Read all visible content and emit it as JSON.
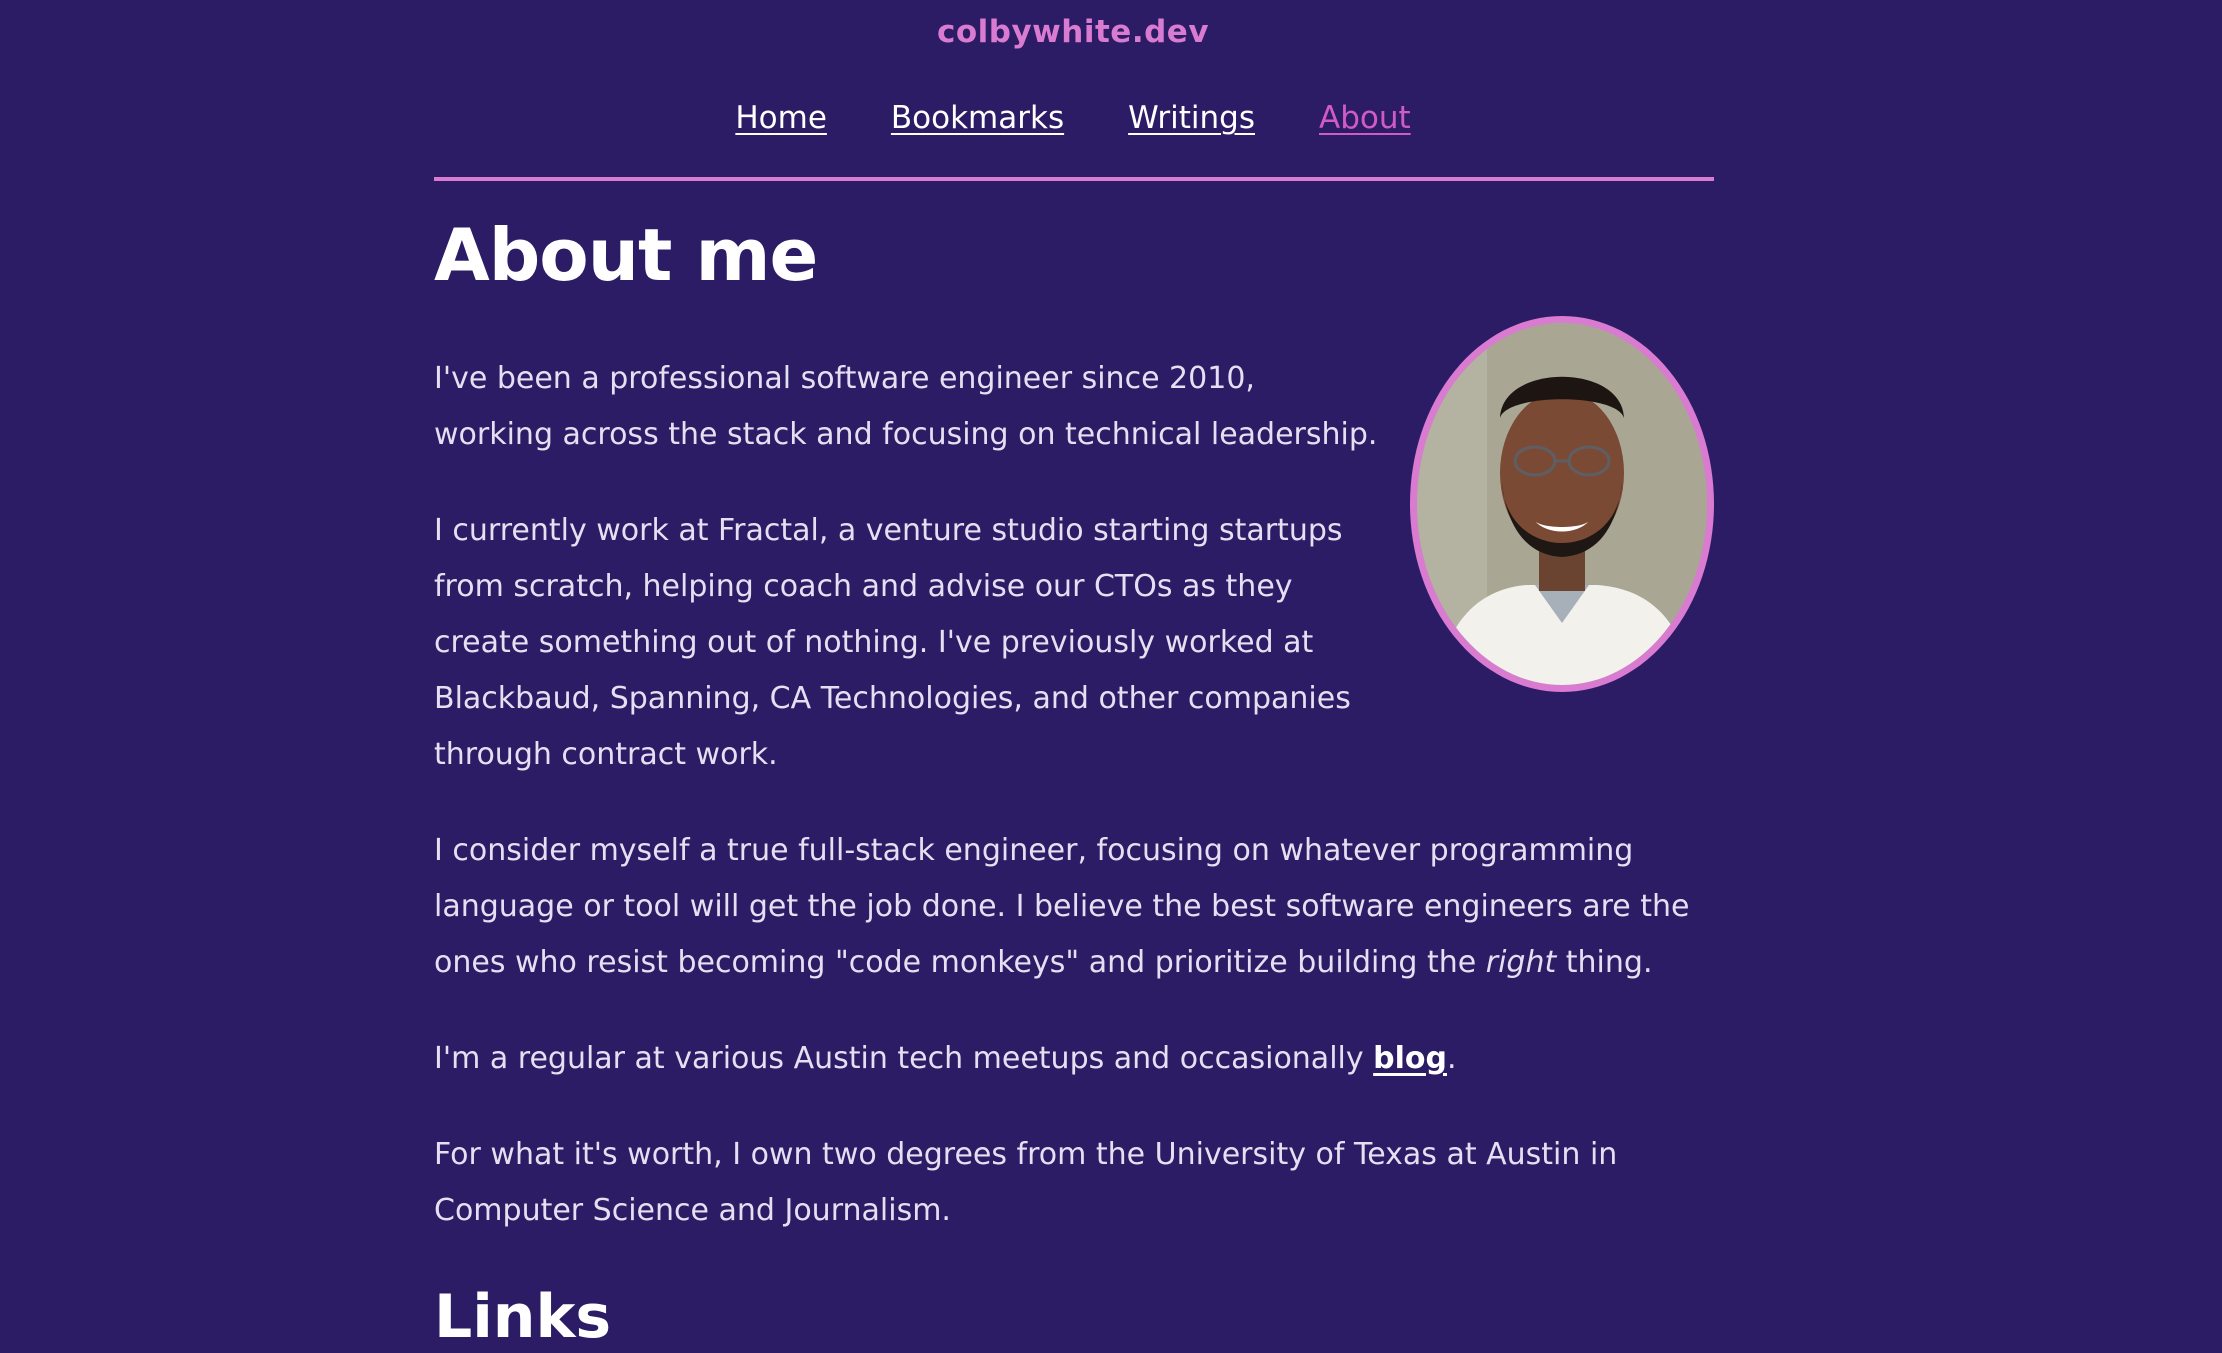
{
  "site": {
    "title": "colbywhite.dev"
  },
  "nav": {
    "items": [
      {
        "label": "Home"
      },
      {
        "label": "Bookmarks"
      },
      {
        "label": "Writings"
      },
      {
        "label": "About",
        "active": true
      }
    ]
  },
  "main": {
    "heading": "About me",
    "paragraphs": {
      "p1": "I've been a professional software engineer since 2010, working across the stack and focusing on technical leadership.",
      "p2": "I currently work at Fractal, a venture studio starting startups from scratch, helping coach and advise our CTOs as they create something out of nothing. I've previously worked at Blackbaud, Spanning, CA Technologies, and other companies through contract work.",
      "p3_before": "I consider myself a true full-stack engineer, focusing on whatever programming language or tool will get the job done. I believe the best software engineers are the ones who resist becoming \"code monkeys\" and prioritize building the ",
      "p3_em": "right",
      "p3_after": " thing.",
      "p4_before": "I'm a regular at various Austin tech meetups and occasionally ",
      "p4_link": "blog",
      "p4_after": ".",
      "p5": "For what it's worth, I own two degrees from the University of Texas at Austin in Computer Science and Journalism."
    },
    "links_heading": "Links"
  },
  "colors": {
    "background": "#2b1c65",
    "accent": "#d97bd0",
    "active_link": "#d05bc4",
    "text": "#e4e0f2"
  }
}
